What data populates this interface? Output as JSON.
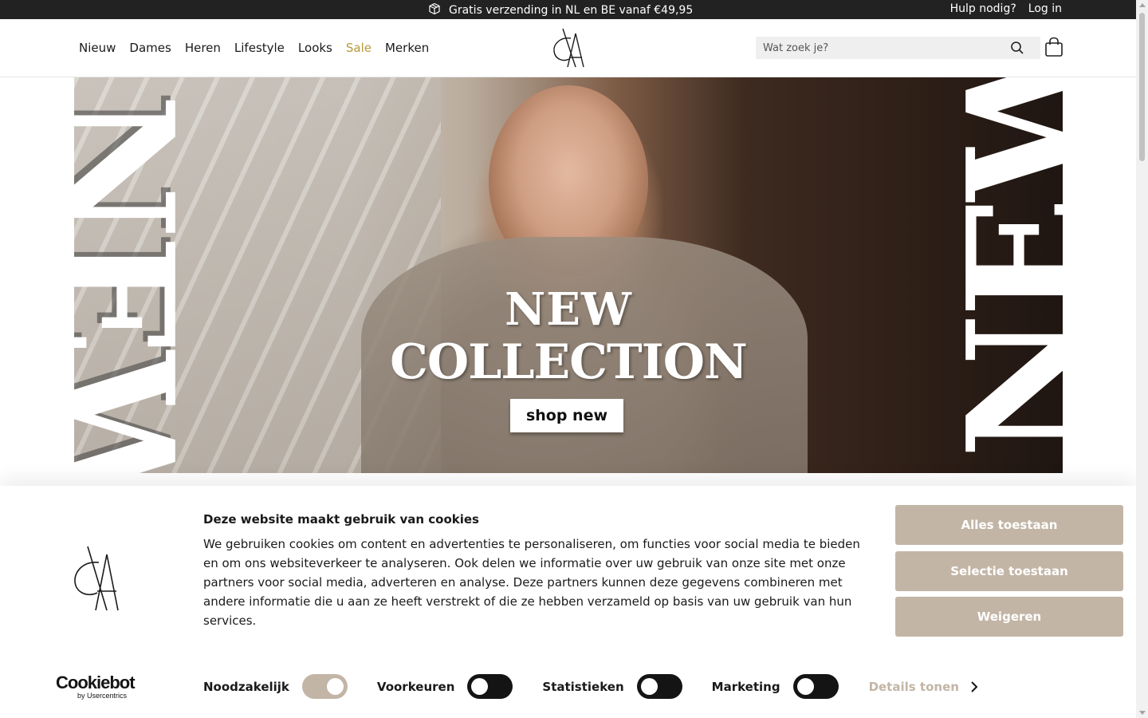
{
  "topbar": {
    "promo_text": "Gratis verzending in NL en BE vanaf €49,95",
    "promo_icon": "package-icon",
    "help_label": "Hulp nodig?",
    "login_label": "Log in"
  },
  "nav": {
    "items": [
      {
        "label": "Nieuw"
      },
      {
        "label": "Dames"
      },
      {
        "label": "Heren"
      },
      {
        "label": "Lifestyle"
      },
      {
        "label": "Looks"
      },
      {
        "label": "Sale",
        "color": "#b89a3c"
      },
      {
        "label": "Merken"
      }
    ]
  },
  "search": {
    "placeholder": "Wat zoek je?",
    "value": ""
  },
  "hero": {
    "side_left": "NEW",
    "side_right": "NEW",
    "headline_line1": "NEW",
    "headline_line2": "COLLECTION",
    "cta_label": "shop new"
  },
  "cookie": {
    "title": "Deze website maakt gebruik van cookies",
    "body": "We gebruiken cookies om content en advertenties te personaliseren, om functies voor social media te bieden en om ons websiteverkeer te analyseren. Ook delen we informatie over uw gebruik van onze site met onze partners voor social media, adverteren en analyse. Deze partners kunnen deze gegevens combineren met andere informatie die u aan ze heeft verstrekt of die ze hebben verzameld op basis van uw gebruik van hun services.",
    "allow_all_label": "Alles toestaan",
    "allow_selection_label": "Selectie toestaan",
    "deny_label": "Weigeren",
    "toggles": [
      {
        "label": "Noodzakelijk",
        "on": true
      },
      {
        "label": "Voorkeuren",
        "on": false
      },
      {
        "label": "Statistieken",
        "on": false
      },
      {
        "label": "Marketing",
        "on": false
      }
    ],
    "details_label": "Details tonen",
    "brand_main": "Cookiebot",
    "brand_sub": "by Usercentrics",
    "accent_color": "#c3b5a6"
  }
}
